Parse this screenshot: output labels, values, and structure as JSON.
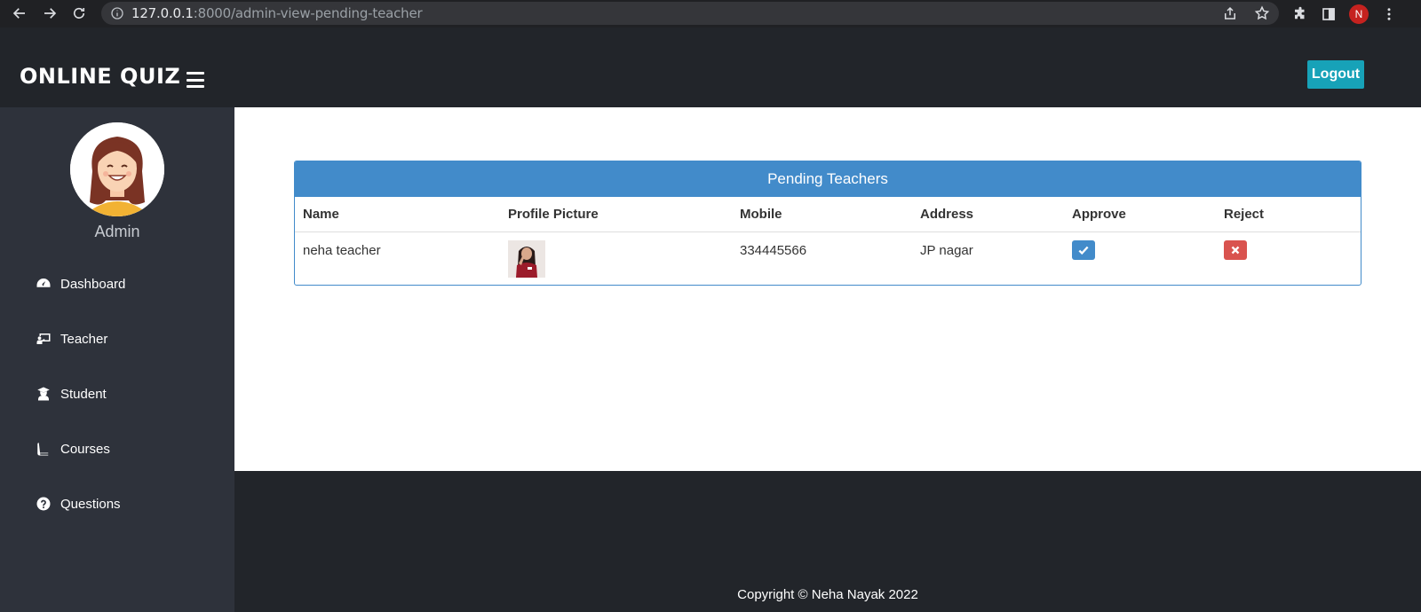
{
  "browser": {
    "url_host": "127.0.0.1",
    "url_rest": ":8000/admin-view-pending-teacher",
    "profile_initial": "N"
  },
  "header": {
    "brand": "ONLINE QUIZ",
    "logout_label": "Logout"
  },
  "sidebar": {
    "user_name": "Admin",
    "items": [
      {
        "label": "Dashboard",
        "icon": "dashboard-icon"
      },
      {
        "label": "Teacher",
        "icon": "teacher-icon"
      },
      {
        "label": "Student",
        "icon": "student-icon"
      },
      {
        "label": "Courses",
        "icon": "book-icon"
      },
      {
        "label": "Questions",
        "icon": "question-icon"
      }
    ]
  },
  "panel": {
    "title": "Pending Teachers",
    "columns": [
      "Name",
      "Profile Picture",
      "Mobile",
      "Address",
      "Approve",
      "Reject"
    ],
    "rows": [
      {
        "name": "neha teacher",
        "mobile": "334445566",
        "address": "JP nagar"
      }
    ]
  },
  "footer": {
    "copyright": "Copyright © Neha Nayak 2022"
  },
  "colors": {
    "header_bg": "#22252a",
    "sidebar_bg": "#2e323b",
    "panel_blue": "#428bca",
    "logout": "#17a2b8",
    "reject": "#d9534f"
  }
}
